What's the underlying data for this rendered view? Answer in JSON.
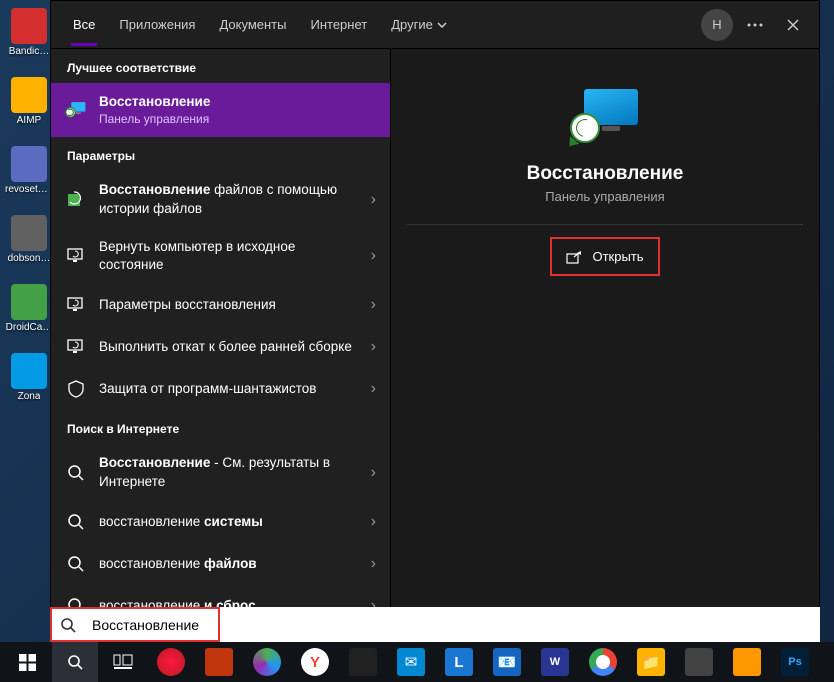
{
  "desktop": {
    "icons": [
      {
        "label": "Bandic…",
        "color": "#d32f2f"
      },
      {
        "label": "AIMP",
        "color": "#ffb300"
      },
      {
        "label": "revosetu…",
        "color": "#5c6bc0"
      },
      {
        "label": "dobson…",
        "color": "#616161"
      },
      {
        "label": "DroidCa…",
        "color": "#43a047"
      },
      {
        "label": "Zona",
        "color": "#039be5"
      }
    ]
  },
  "tabs": {
    "all": "Все",
    "apps": "Приложения",
    "docs": "Документы",
    "internet": "Интернет",
    "more": "Другие"
  },
  "topbar": {
    "avatar_initial": "H"
  },
  "left": {
    "best_header": "Лучшее соответствие",
    "best": {
      "title": "Восстановление",
      "sub": "Панель управления"
    },
    "params_header": "Параметры",
    "params": [
      {
        "bold": "Восстановление",
        "rest": " файлов с помощью истории файлов"
      },
      {
        "bold": "",
        "rest": "Вернуть компьютер в исходное состояние"
      },
      {
        "bold": "",
        "rest": "Параметры восстановления"
      },
      {
        "bold": "",
        "rest": "Выполнить откат к более ранней сборке"
      },
      {
        "bold": "",
        "rest": "Защита от программ-шантажистов"
      }
    ],
    "web_header": "Поиск в Интернете",
    "web": [
      {
        "bold": "Восстановление",
        "rest": " - См. результаты в Интернете"
      },
      {
        "pre": "восстановление ",
        "bold": "системы"
      },
      {
        "pre": "восстановление ",
        "bold": "файлов"
      },
      {
        "pre": "восстановление ",
        "bold": "и сброс"
      }
    ]
  },
  "right": {
    "title": "Восстановление",
    "sub": "Панель управления",
    "open": "Открыть"
  },
  "search": {
    "value": "Восстановление"
  }
}
